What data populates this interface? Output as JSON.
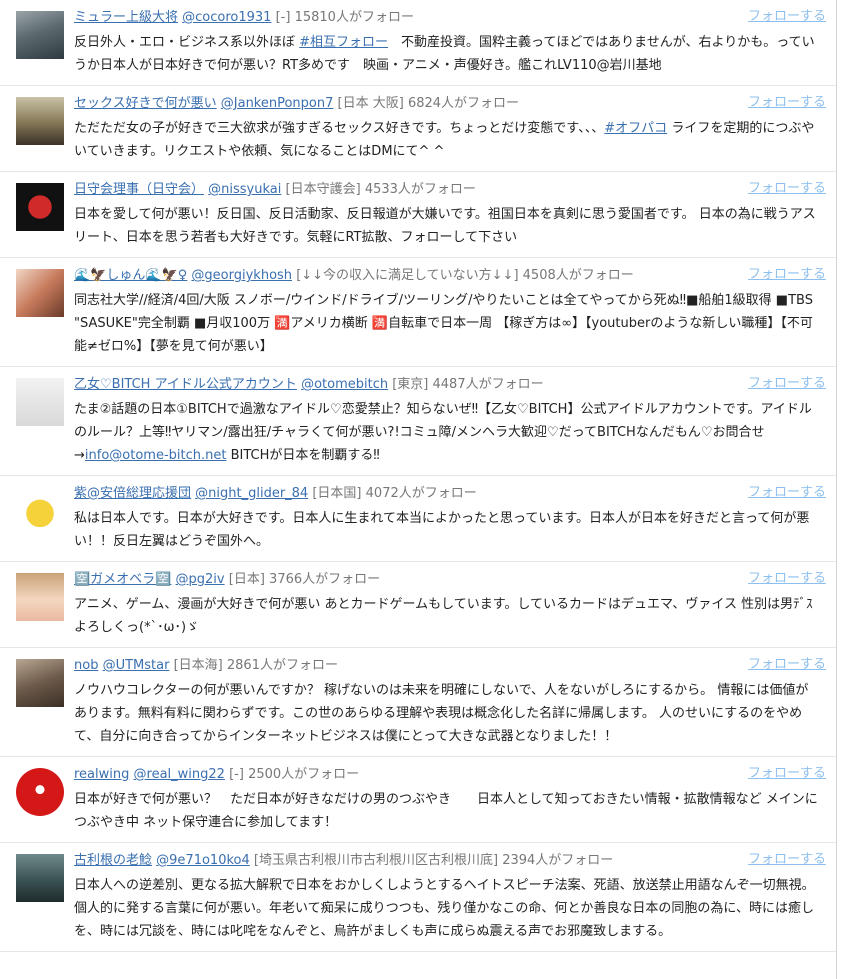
{
  "follow_label": "フォローする",
  "follow_link_color": "#8ec0ef",
  "link_color": "#3a6fb0",
  "users": [
    {
      "name": "ミュラー上級大将",
      "handle": "@cocoro1931",
      "location": "[-]",
      "followers": "15810人がフォロー",
      "bio_parts": [
        {
          "t": "反日外人・エロ・ビジネス系以外ほぼ "
        },
        {
          "t": "#相互フォロー",
          "link": true
        },
        {
          "t": "　不動産投資。国粋主義ってほどではありませんが、右よりかも。っていうか日本人が日本好きで何が悪い？RT多めです　映画・アニメ・声優好き。艦これLV110@岩川基地"
        }
      ]
    },
    {
      "name": "セックス好きで何が悪い",
      "handle": "@JankenPonpon7",
      "location": "[日本 大阪]",
      "followers": "6824人がフォロー",
      "bio_parts": [
        {
          "t": "ただただ女の子が好きで三大欲求が強すぎるセックス好きです。ちょっとだけ変態です、、、"
        },
        {
          "t": "#オフパコ",
          "link": true
        },
        {
          "t": " ライフを定期的につぶやいていきます。リクエストや依頼、気になることはDMにて^ ^"
        }
      ]
    },
    {
      "name": "日守会理事（日守会）",
      "handle": "@nissyukai",
      "location": "[日本守護会]",
      "followers": "4533人がフォロー",
      "bio_parts": [
        {
          "t": "日本を愛して何が悪い！反日国、反日活動家、反日報道が大嫌いです。祖国日本を真剣に思う愛国者です。 日本の為に戦うアスリート、日本を思う若者も大好きです。気軽にRT拡散、フォローして下さい"
        }
      ]
    },
    {
      "name": "🌊🦅しゅん🌊🦅♀",
      "handle": "@georgiykhosh",
      "location": "[↓↓今の収入に満足していない方↓↓]",
      "followers": "4508人がフォロー",
      "bio_parts": [
        {
          "t": "同志社大学//経済/4回/大阪 スノボー/ウインド/ドライブ/ツーリング/やりたいことは全てやってから死ぬ‼■船舶1級取得 ■TBS \"SASUKE\"完全制覇 ■月収100万 🈵アメリカ横断 🈵自転車で日本一周 【稼ぎ方は∞】【youtuberのような新しい職種】【不可能≠ゼロ%】【夢を見て何が悪い】"
        }
      ]
    },
    {
      "name": "乙女♡BITCH アイドル公式アカウント",
      "handle": "@otomebitch",
      "location": "[東京]",
      "followers": "4487人がフォロー",
      "bio_parts": [
        {
          "t": "たま②話題の日本①BITCHで過激なアイドル♡恋愛禁止？知らないぜ‼【乙女♡BITCH】公式アイドルアカウントです。アイドルのルール？上等‼ヤリマン/露出狂/チャラくて何が悪い?!コミュ障/メンヘラ大歓迎♡だってBITCHなんだもん♡お問合せ→"
        },
        {
          "t": "info@otome-bitch.net",
          "link": true
        },
        {
          "t": " BITCHが日本を制覇する‼"
        }
      ]
    },
    {
      "name": "紫@安倍総理応援団",
      "handle": "@night_glider_84",
      "location": "[日本国]",
      "followers": "4072人がフォロー",
      "bio_parts": [
        {
          "t": "私は日本人です。日本が大好きです。日本人に生まれて本当によかったと思っています。日本人が日本を好きだと言って何が悪い！！反日左翼はどうぞ国外へ。"
        }
      ]
    },
    {
      "name": "🈳ガメオベラ🈳",
      "handle": "@pg2iv",
      "location": "[日本]",
      "followers": "3766人がフォロー",
      "bio_parts": [
        {
          "t": "アニメ、ゲーム、漫画が大好きで何が悪い あとカードゲームもしています。しているカードはデュエマ、ヴァイス 性別は男ﾃﾞｽよろしくっ(*ˋ･ω･)ゞ"
        }
      ]
    },
    {
      "name": "nob",
      "handle": "@UTMstar",
      "location": "[日本海]",
      "followers": "2861人がフォロー",
      "bio_parts": [
        {
          "t": "ノウハウコレクターの何が悪いんですか？ 稼げないのは未来を明確にしないで、人をないがしろにするから。 情報には価値があります。無料有料に関わらずです。この世のあらゆる理解や表現は概念化した名詳に帰属します。 人のせいにするのをやめて、自分に向き合ってからインターネットビジネスは僕にとって大きな武器となりました！！"
        }
      ]
    },
    {
      "name": "realwing",
      "handle": "@real_wing22",
      "location": "[-]",
      "followers": "2500人がフォロー",
      "bio_parts": [
        {
          "t": "日本が好きで何が悪い？　ただ日本が好きなだけの男のつぶやき　　日本人として知っておきたい情報・拡散情報など メインにつぶやき中 ネット保守連合に参加してます！"
        }
      ]
    },
    {
      "name": "古利根の老鯰",
      "handle": "@9e71o10ko4",
      "location": "[埼玉県古利根川市古利根川区古利根川底]",
      "followers": "2394人がフォロー",
      "bio_parts": [
        {
          "t": "日本人への逆差別、更なる拡大解釈で日本をおかしくしようとするヘイトスピーチ法案、死語、放送禁止用語なんぞ一切無視。個人的に発する言葉に何が悪い。年老いて痴呆に成りつつも、残り僅かなこの命、何とか善良な日本の同胞の為に、時には癒しを、時には冗談を、時には叱咤をなんぞと、烏許がましくも声に成らぬ震える声でお邪魔致しまする。"
        }
      ]
    }
  ]
}
